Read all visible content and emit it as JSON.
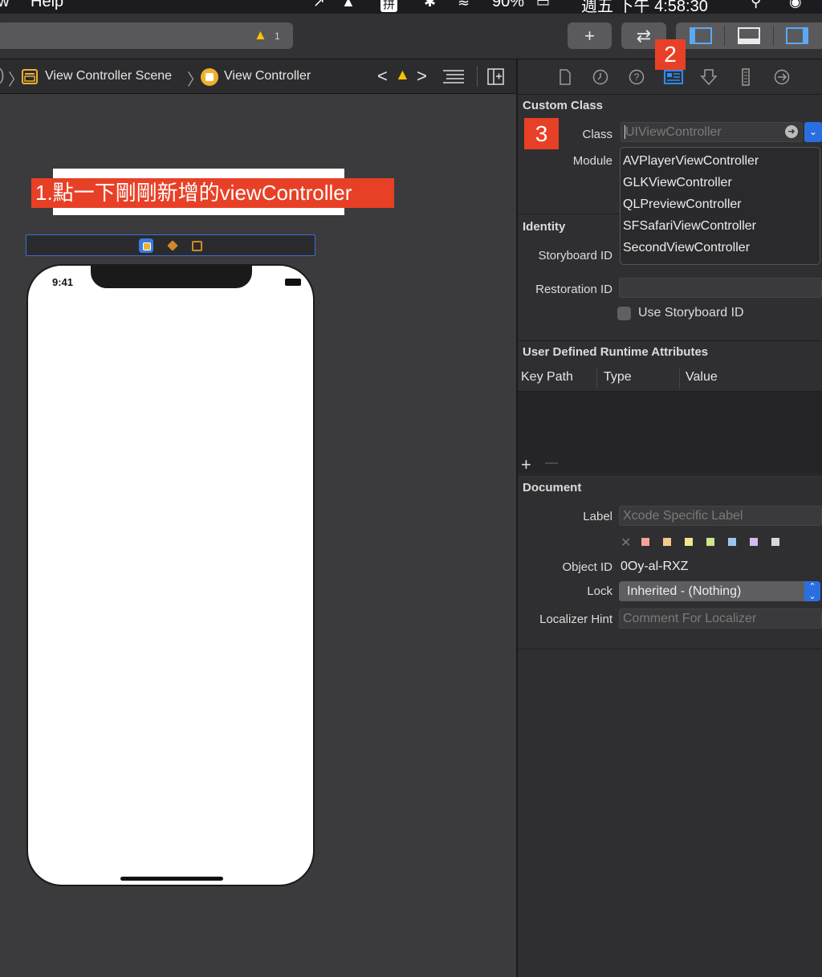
{
  "menubar": {
    "left_text": "w",
    "help": "Help",
    "icons": [
      "airplay-icon",
      "input-method-icon",
      "bluetooth-icon",
      "wifi-icon",
      "battery-icon",
      "spotlight-icon",
      "siri-icon"
    ],
    "ime": "拼",
    "battery_text": "90%",
    "clock": "週五 下午 4:58:30"
  },
  "toolbar": {
    "warning_count": "1",
    "add_symbol": "+",
    "swap_symbol": "⇄"
  },
  "jumpbar": {
    "scene": "View Controller Scene",
    "controller": "View Controller"
  },
  "canvas": {
    "callout": "1.點一下剛剛新增的viewController",
    "time": "9:41"
  },
  "inspector": {
    "step2": "2",
    "step3": "3",
    "custom_class": {
      "heading": "Custom Class",
      "class_label": "Class",
      "class_placeholder": "UIViewController",
      "module_label": "Module",
      "options": [
        "AVPlayerViewController",
        "GLKViewController",
        "QLPreviewController",
        "SFSafariViewController",
        "SecondViewController"
      ]
    },
    "identity": {
      "heading": "Identity",
      "storyboard_id_label": "Storyboard ID",
      "restoration_id_label": "Restoration ID",
      "use_storyboard_id": "Use Storyboard ID"
    },
    "udr": {
      "heading": "User Defined Runtime Attributes",
      "columns": [
        "Key Path",
        "Type",
        "Value"
      ],
      "add": "+",
      "remove": "—"
    },
    "document": {
      "heading": "Document",
      "label_label": "Label",
      "label_placeholder": "Xcode Specific Label",
      "swatches": [
        "#f2a39a",
        "#f4c98c",
        "#f2e68d",
        "#cfe58e",
        "#9ec5f0",
        "#d9b8ea",
        "#d8d8d8"
      ],
      "object_id_label": "Object ID",
      "object_id": "0Oy-al-RXZ",
      "lock_label": "Lock",
      "lock_value": "Inherited - (Nothing)",
      "localizer_label": "Localizer Hint",
      "localizer_placeholder": "Comment For Localizer"
    }
  }
}
